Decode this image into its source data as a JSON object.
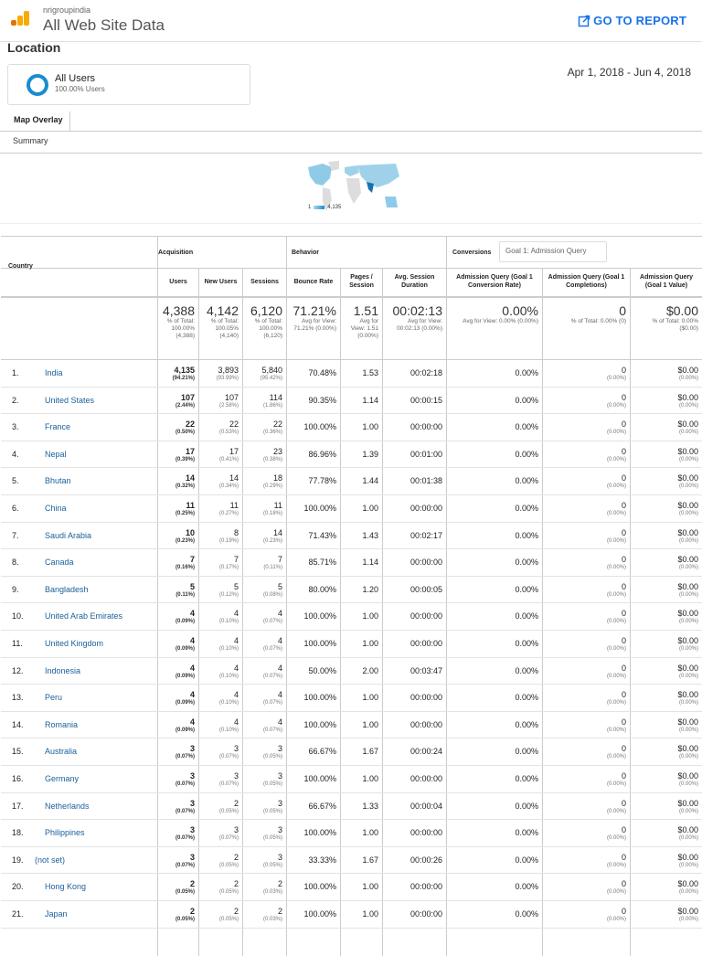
{
  "header": {
    "account": "nrigroupindia",
    "property": "All Web Site Data",
    "go_to_report": "GO TO REPORT"
  },
  "page_title": "Location",
  "segment": {
    "name": "All Users",
    "sub": "100.00% Users"
  },
  "date_range": "Apr 1, 2018 - Jun 4, 2018",
  "tabs": {
    "map_overlay": "Map Overlay",
    "summary": "Summary"
  },
  "map": {
    "legend_min": "1",
    "legend_max": "4,135",
    "colors": {
      "low": "#a9d8ef",
      "high": "#1a8ccf"
    }
  },
  "table": {
    "groups": {
      "acquisition": "Acquisition",
      "behavior": "Behavior",
      "conversions": "Conversions"
    },
    "goal_select": "Goal 1: Admission Query",
    "headers": {
      "country": "Country",
      "users": "Users",
      "new_users": "New Users",
      "sessions": "Sessions",
      "bounce": "Bounce Rate",
      "pages": "Pages / Session",
      "duration": "Avg. Session Duration",
      "conv_rate": "Admission Query (Goal 1 Conversion Rate)",
      "completions": "Admission Query (Goal 1 Completions)",
      "value": "Admission Query (Goal 1 Value)"
    },
    "totals": {
      "users": "4,388",
      "users_sub": "% of Total: 100.00% (4,388)",
      "new_users": "4,142",
      "new_users_sub": "% of Total: 100.05% (4,140)",
      "sessions": "6,120",
      "sessions_sub": "% of Total: 100.00% (6,120)",
      "bounce": "71.21%",
      "bounce_sub": "Avg for View: 71.21% (0.00%)",
      "pages": "1.51",
      "pages_sub": "Avg for View: 1.51 (0.00%)",
      "duration": "00:02:13",
      "duration_sub": "Avg for View: 00:02:13 (0.00%)",
      "conv_rate": "0.00%",
      "conv_rate_sub": "Avg for View: 0.00% (0.00%)",
      "completions": "0",
      "completions_sub": "% of Total: 0.00% (0)",
      "value": "$0.00",
      "value_sub": "% of Total: 0.00% ($0.00)"
    },
    "rows": [
      [
        "1.",
        "India",
        "4,135",
        "(94.21%)",
        "3,893",
        "(93.99%)",
        "5,840",
        "(95.42%)",
        "70.48%",
        "1.53",
        "00:02:18"
      ],
      [
        "2.",
        "United States",
        "107",
        "(2.44%)",
        "107",
        "(2.58%)",
        "114",
        "(1.86%)",
        "90.35%",
        "1.14",
        "00:00:15"
      ],
      [
        "3.",
        "France",
        "22",
        "(0.50%)",
        "22",
        "(0.53%)",
        "22",
        "(0.36%)",
        "100.00%",
        "1.00",
        "00:00:00"
      ],
      [
        "4.",
        "Nepal",
        "17",
        "(0.39%)",
        "17",
        "(0.41%)",
        "23",
        "(0.38%)",
        "86.96%",
        "1.39",
        "00:01:00"
      ],
      [
        "5.",
        "Bhutan",
        "14",
        "(0.32%)",
        "14",
        "(0.34%)",
        "18",
        "(0.29%)",
        "77.78%",
        "1.44",
        "00:01:38"
      ],
      [
        "6.",
        "China",
        "11",
        "(0.25%)",
        "11",
        "(0.27%)",
        "11",
        "(0.18%)",
        "100.00%",
        "1.00",
        "00:00:00"
      ],
      [
        "7.",
        "Saudi Arabia",
        "10",
        "(0.23%)",
        "8",
        "(0.19%)",
        "14",
        "(0.23%)",
        "71.43%",
        "1.43",
        "00:02:17"
      ],
      [
        "8.",
        "Canada",
        "7",
        "(0.16%)",
        "7",
        "(0.17%)",
        "7",
        "(0.11%)",
        "85.71%",
        "1.14",
        "00:00:00"
      ],
      [
        "9.",
        "Bangladesh",
        "5",
        "(0.11%)",
        "5",
        "(0.12%)",
        "5",
        "(0.08%)",
        "80.00%",
        "1.20",
        "00:00:05"
      ],
      [
        "10.",
        "United Arab Emirates",
        "4",
        "(0.09%)",
        "4",
        "(0.10%)",
        "4",
        "(0.07%)",
        "100.00%",
        "1.00",
        "00:00:00"
      ],
      [
        "11.",
        "United Kingdom",
        "4",
        "(0.09%)",
        "4",
        "(0.10%)",
        "4",
        "(0.07%)",
        "100.00%",
        "1.00",
        "00:00:00"
      ],
      [
        "12.",
        "Indonesia",
        "4",
        "(0.09%)",
        "4",
        "(0.10%)",
        "4",
        "(0.07%)",
        "50.00%",
        "2.00",
        "00:03:47"
      ],
      [
        "13.",
        "Peru",
        "4",
        "(0.09%)",
        "4",
        "(0.10%)",
        "4",
        "(0.07%)",
        "100.00%",
        "1.00",
        "00:00:00"
      ],
      [
        "14.",
        "Romania",
        "4",
        "(0.09%)",
        "4",
        "(0.10%)",
        "4",
        "(0.07%)",
        "100.00%",
        "1.00",
        "00:00:00"
      ],
      [
        "15.",
        "Australia",
        "3",
        "(0.07%)",
        "3",
        "(0.07%)",
        "3",
        "(0.05%)",
        "66.67%",
        "1.67",
        "00:00:24"
      ],
      [
        "16.",
        "Germany",
        "3",
        "(0.07%)",
        "3",
        "(0.07%)",
        "3",
        "(0.05%)",
        "100.00%",
        "1.00",
        "00:00:00"
      ],
      [
        "17.",
        "Netherlands",
        "3",
        "(0.07%)",
        "2",
        "(0.05%)",
        "3",
        "(0.05%)",
        "66.67%",
        "1.33",
        "00:00:04"
      ],
      [
        "18.",
        "Philippines",
        "3",
        "(0.07%)",
        "3",
        "(0.07%)",
        "3",
        "(0.05%)",
        "100.00%",
        "1.00",
        "00:00:00"
      ],
      [
        "19.",
        "(not set)",
        "3",
        "(0.07%)",
        "2",
        "(0.05%)",
        "3",
        "(0.05%)",
        "33.33%",
        "1.67",
        "00:00:26"
      ],
      [
        "20.",
        "Hong Kong",
        "2",
        "(0.05%)",
        "2",
        "(0.05%)",
        "2",
        "(0.03%)",
        "100.00%",
        "1.00",
        "00:00:00"
      ],
      [
        "21.",
        "Japan",
        "2",
        "(0.05%)",
        "2",
        "(0.05%)",
        "2",
        "(0.03%)",
        "100.00%",
        "1.00",
        "00:00:00"
      ]
    ],
    "row_conv_rate": "0.00%",
    "row_completions": "0",
    "row_value": "$0.00",
    "row_pct_zero": "(0.00%)"
  }
}
